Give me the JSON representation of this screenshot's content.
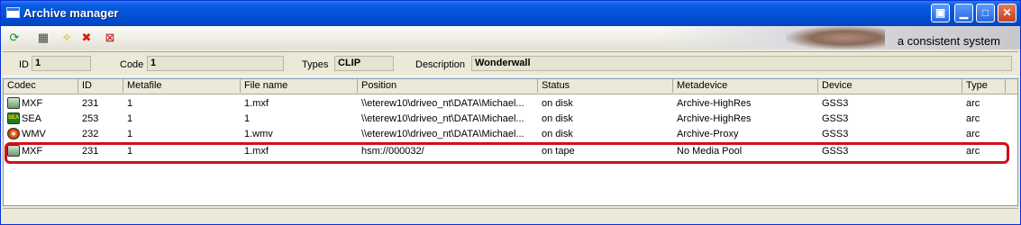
{
  "window": {
    "title": "Archive manager"
  },
  "title_buttons": [
    {
      "name": "restore-pane-button",
      "glyph": "▣"
    },
    {
      "name": "minimize-button",
      "glyph": "▁"
    },
    {
      "name": "maximize-button",
      "glyph": "□"
    },
    {
      "name": "close-button",
      "glyph": "✕"
    }
  ],
  "toolbar": {
    "icons": [
      {
        "name": "refresh-icon",
        "glyph": "⟳"
      },
      {
        "name": "media-icon",
        "glyph": "▦"
      },
      {
        "name": "open-icon",
        "glyph": "✧"
      },
      {
        "name": "delete-icon",
        "glyph": "✖"
      },
      {
        "name": "remove-media-icon",
        "glyph": "⊠"
      }
    ],
    "banner_text": "a consistent system"
  },
  "info": {
    "id_label": "ID",
    "id_value": "1",
    "code_label": "Code",
    "code_value": "1",
    "types_label": "Types",
    "types_value": "CLIP",
    "description_label": "Description",
    "description_value": "Wonderwall"
  },
  "table": {
    "columns": [
      "Codec",
      "ID",
      "Metafile",
      "File name",
      "Position",
      "Status",
      "Metadevice",
      "Device",
      "Type"
    ],
    "rows": [
      {
        "icon": "mxf-codec-icon",
        "codec": "MXF",
        "id": "231",
        "metafile": "1",
        "file_name": "1.mxf",
        "position": "\\\\eterew10\\driveo_nt\\DATA\\Michael...",
        "status": "on disk",
        "metadevice": "Archive-HighRes",
        "device": "GSS3",
        "type": "arc"
      },
      {
        "icon": "sea-codec-icon",
        "codec": "SEA",
        "id": "253",
        "metafile": "1",
        "file_name": "1",
        "position": "\\\\eterew10\\driveo_nt\\DATA\\Michael...",
        "status": "on disk",
        "metadevice": "Archive-HighRes",
        "device": "GSS3",
        "type": "arc"
      },
      {
        "icon": "wmv-codec-icon",
        "codec": "WMV",
        "id": "232",
        "metafile": "1",
        "file_name": "1.wmv",
        "position": "\\\\eterew10\\driveo_nt\\DATA\\Michael...",
        "status": "on disk",
        "metadevice": "Archive-Proxy",
        "device": "GSS3",
        "type": "arc"
      },
      {
        "icon": "mxf-codec-icon",
        "codec": "MXF",
        "id": "231",
        "metafile": "1",
        "file_name": "1.mxf",
        "position": "hsm://000032/",
        "status": "on tape",
        "metadevice": "No Media Pool",
        "device": "GSS3",
        "type": "arc"
      }
    ]
  },
  "colors": {
    "highlight": "#d0101a",
    "titlebar": "#0052d6"
  }
}
